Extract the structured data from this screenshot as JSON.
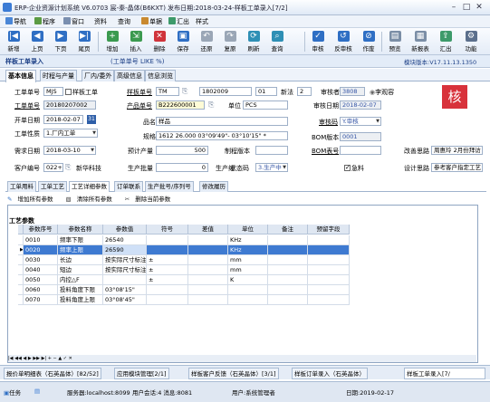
{
  "window": {
    "title": "ERP-企业资源计划系统 V6.0703 宸-秦-晶体(B6KXT) 发布日期:2018-03-24-样板工单录入[7/2]"
  },
  "menu": [
    "导航",
    "程序",
    "窗口",
    "资料",
    "查询",
    "单据",
    "汇出",
    "样式"
  ],
  "toolbar": [
    "新增",
    "上页",
    "下页",
    "尾页",
    "增加",
    "插入",
    "删除",
    "保存",
    "还原",
    "复原",
    "刷新",
    "查询",
    "审核",
    "反审核",
    "作废",
    "预览",
    "新报表",
    "汇出",
    "功能"
  ],
  "header": {
    "title": "样板工单录入",
    "hint": "(工单单号 LIKE %)",
    "version": "模块版本:V17.11.13.1350"
  },
  "main_tabs": [
    "基本信息",
    "时程与产量",
    "厂内/委外",
    "高级信息",
    "信息浏览"
  ],
  "form": {
    "order_type_label": "工单单号",
    "order_type": "MJS",
    "sample_chk_label": "样板工单",
    "sample_no_label": "样板单号",
    "sample_no_prefix": "TM",
    "sample_no": "1802009",
    "sample_no_seq": "01",
    "version_label": "新法",
    "version": "2",
    "auditor_label": "审核者",
    "auditor": "3808",
    "auditor_name": "李观容",
    "order_no_label": "工单单号",
    "order_no": "20180207002",
    "product_label": "产品单号",
    "product": "B222600001",
    "unit_label": "单位",
    "unit": "PCS",
    "audit_date_label": "审核日期",
    "audit_date": "2018-02-07",
    "open_date_label": "开单日期",
    "open_date": "2018-02-07",
    "name_label": "品名",
    "name": "样品",
    "audit_code_label": "审核码",
    "audit_code": "Y.审核",
    "order_nature_label": "工单性质",
    "order_nature": "1.厂内工单",
    "spec_label": "规格",
    "spec": "1612 26.000 03°09'49\"- 03°10'15\" *",
    "bom_ver_label": "BOM版本",
    "bom_ver": "0001",
    "need_date_label": "需求日期",
    "need_date": "2018-03-10",
    "plan_qty_label": "预计产量",
    "plan_qty": "500",
    "make_ver_label": "制程版本",
    "bom_tbl_label": "BOM表号",
    "change_label": "改善思路",
    "change_val": "周惠玲 2月份拜访",
    "cust_label": "客户编号",
    "cust": "022+",
    "cust_name": "新华科技",
    "prod_batch_label": "生产批量",
    "prod_batch": "0",
    "prod_line_label": "生产线",
    "status_label": "状态码",
    "status": "3.生产中",
    "urgent_label": "急料",
    "design_label": "设计思路",
    "design": "参考客户指定工艺",
    "stamp": "核"
  },
  "sub_tabs": [
    "工单用料",
    "工单工艺",
    "工艺详细参数",
    "订单联系",
    "生产批号/序列号",
    "修改履历"
  ],
  "actions": [
    "增加所有参数",
    "清除所有参数",
    "删除当前参数"
  ],
  "grid": {
    "title": "工艺参数",
    "columns": [
      "参数序号",
      "参数名称",
      "参数值",
      "符号",
      "差值",
      "单位",
      "备注",
      "预留字段"
    ],
    "rows": [
      [
        "0010",
        "频率下限",
        "26540",
        "",
        "",
        "KHz",
        "",
        ""
      ],
      [
        "0020",
        "频率上限",
        "26590",
        "",
        "",
        "KHz",
        "",
        ""
      ],
      [
        "0030",
        "长边",
        "按实际尺寸标注",
        "±",
        "",
        "mm",
        "",
        ""
      ],
      [
        "0040",
        "短边",
        "按实际尺寸标注",
        "±",
        "",
        "mm",
        "",
        ""
      ],
      [
        "0050",
        "内控△F",
        "",
        "±",
        "",
        "K",
        "",
        ""
      ],
      [
        "0060",
        "投料角度下限",
        "03°08'15\"",
        "",
        "",
        "",
        "",
        ""
      ],
      [
        "0070",
        "投料角度上限",
        "03°08'45\"",
        "",
        "",
        "",
        "",
        ""
      ]
    ]
  },
  "bottom_tabs": [
    "报价单明细表（石英晶体）[82/52]",
    "应用模块管理[2/1]",
    "样板客户反馈（石英晶体）[3/1]",
    "样板订单录入（石英晶体）",
    "样板工单录入[7/"
  ],
  "status": {
    "task": "任务",
    "server": "服务器:localhost:8099",
    "session": "用户会话:4 消息:8081",
    "user": "用户:系统管理者",
    "date": "日期:2019-02-17"
  }
}
